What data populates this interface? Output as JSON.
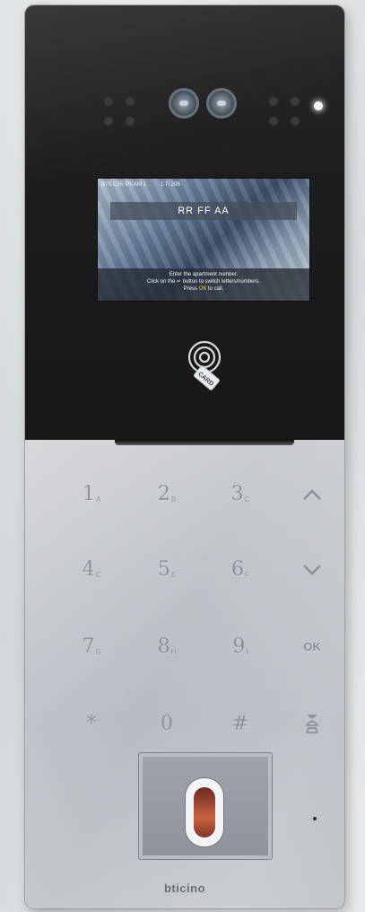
{
  "screen": {
    "status_left": "BTS C55 IPCAM 1",
    "status_mid": "1 TI 20B",
    "input_value": "RR FF AA",
    "message_line1": "Enter the apartment number.",
    "message_line2": "Click on the ↵ button to switch letters/numbers.",
    "message_line3_pre": "Press ",
    "message_line3_ok": "OK",
    "message_line3_post": " to call."
  },
  "rfid": {
    "tag_label": "CARD"
  },
  "keypad": {
    "k1": {
      "digit": "1",
      "letter": "A"
    },
    "k2": {
      "digit": "2",
      "letter": "B"
    },
    "k3": {
      "digit": "3",
      "letter": "C"
    },
    "k4": {
      "digit": "4",
      "letter": "C"
    },
    "k5": {
      "digit": "5",
      "letter": "E"
    },
    "k6": {
      "digit": "6",
      "letter": "F"
    },
    "k7": {
      "digit": "7",
      "letter": "G"
    },
    "k8": {
      "digit": "8",
      "letter": "H"
    },
    "k9": {
      "digit": "9",
      "letter": "I"
    },
    "ok_label": "OK",
    "star_label": "*",
    "zero_label": "0",
    "hash_label": "#"
  },
  "icons": {
    "up": "chevron-up-icon",
    "down": "chevron-down-icon",
    "concierge": "concierge-icon",
    "camera": "camera-icon",
    "fingerprint": "fingerprint-sensor-icon"
  },
  "colors": {
    "ok_highlight": "#f3d33b",
    "key_text": "#8b9197"
  },
  "brand": "bticino"
}
